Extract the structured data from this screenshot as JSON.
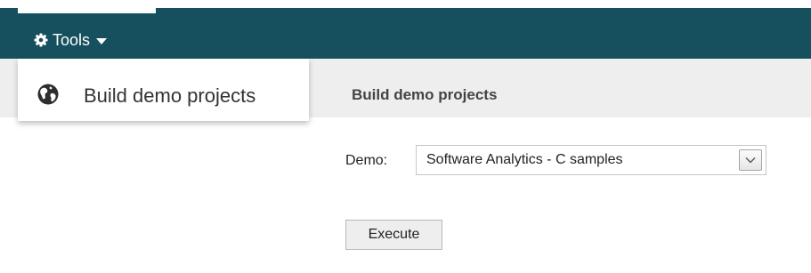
{
  "navbar": {
    "tools_label": "Tools",
    "tools_icon": "gear-icon",
    "background_color": "#16505e"
  },
  "dropdown": {
    "items": [
      {
        "label": "Build demo projects",
        "icon": "globe-icon"
      }
    ]
  },
  "page": {
    "title": "Build demo projects"
  },
  "form": {
    "demo_label": "Demo:",
    "demo_selected": "Software Analytics - C samples",
    "execute_label": "Execute"
  }
}
